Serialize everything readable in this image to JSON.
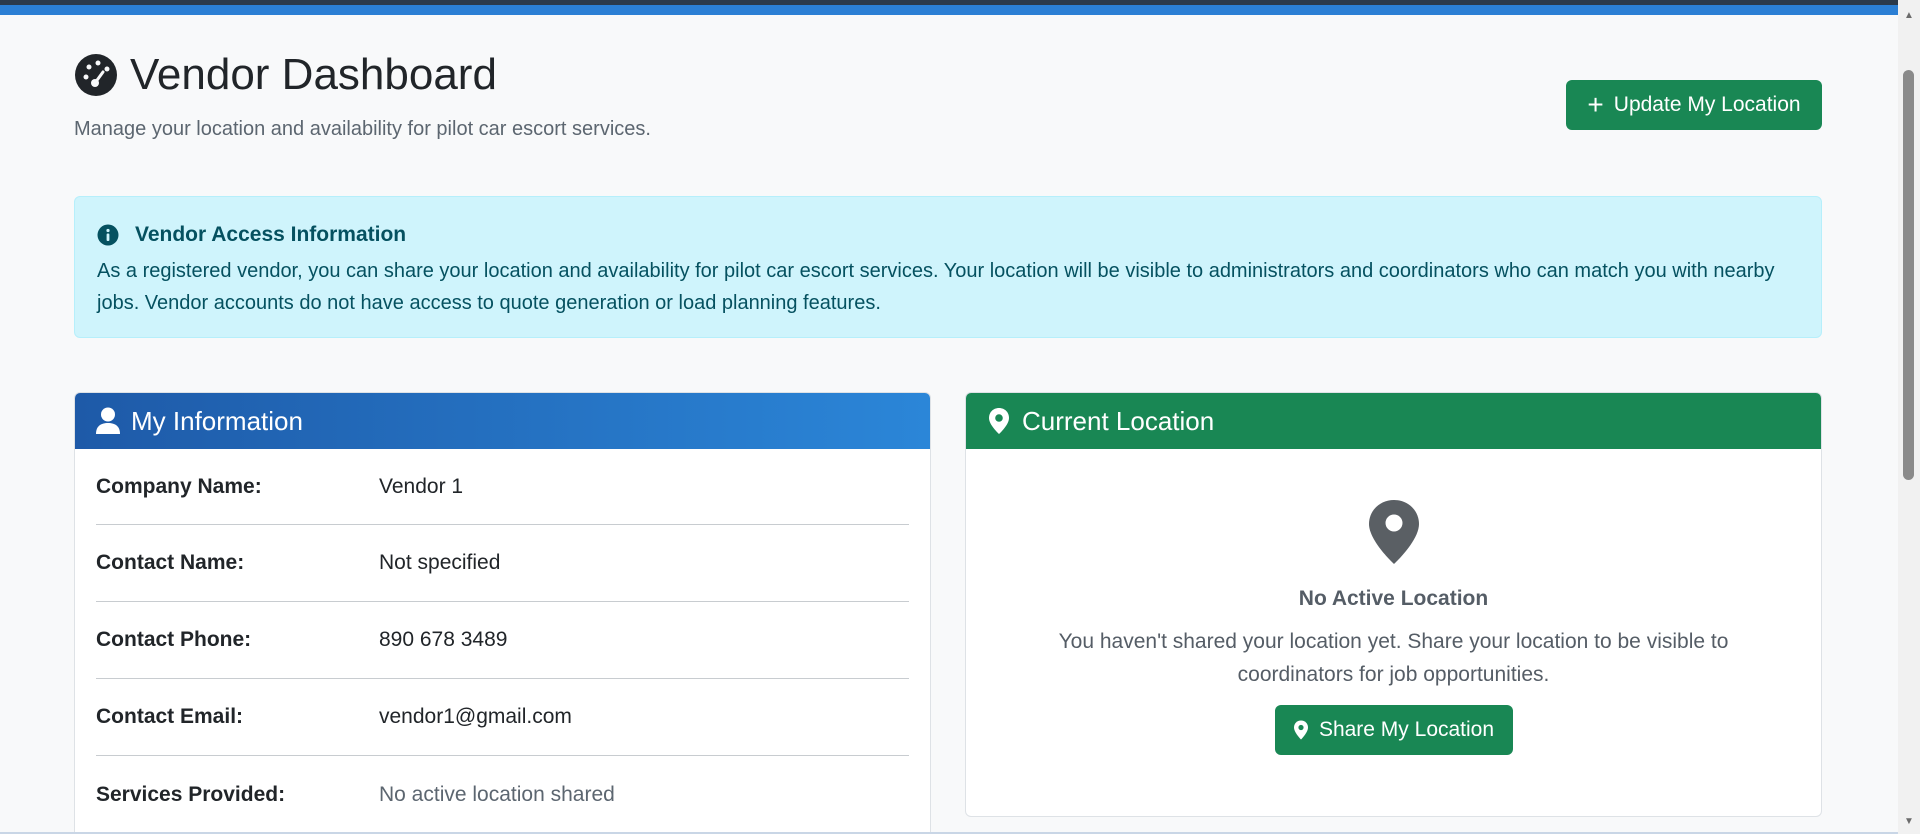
{
  "header": {
    "title": "Vendor Dashboard",
    "subtitle": "Manage your location and availability for pilot car escort services.",
    "update_button_label": "Update My Location",
    "icon": "tachometer-icon"
  },
  "alert": {
    "title": "Vendor Access Information",
    "body": "As a registered vendor, you can share your location and availability for pilot car escort services. Your location will be visible to administrators and coordinators who can match you with nearby jobs. Vendor accounts do not have access to quote generation or load planning features.",
    "icon": "info-circle-icon"
  },
  "info_card": {
    "title": "My Information",
    "icon": "user-icon",
    "rows": [
      {
        "label": "Company Name:",
        "value": "Vendor 1"
      },
      {
        "label": "Contact Name:",
        "value": "Not specified"
      },
      {
        "label": "Contact Phone:",
        "value": "890 678 3489"
      },
      {
        "label": "Contact Email:",
        "value": "vendor1@gmail.com"
      },
      {
        "label": "Services Provided:",
        "value": "No active location shared"
      }
    ]
  },
  "location_card": {
    "title": "Current Location",
    "icon": "map-pin-icon",
    "empty_title": "No Active Location",
    "empty_text": "You haven't shared your location yet. Share your location to be visible to coordinators for job opportunities.",
    "share_button_label": "Share My Location"
  },
  "colors": {
    "success": "#198754",
    "primary": "#2b7fd4",
    "info_bg": "#cff4fc",
    "info_text": "#055160"
  }
}
